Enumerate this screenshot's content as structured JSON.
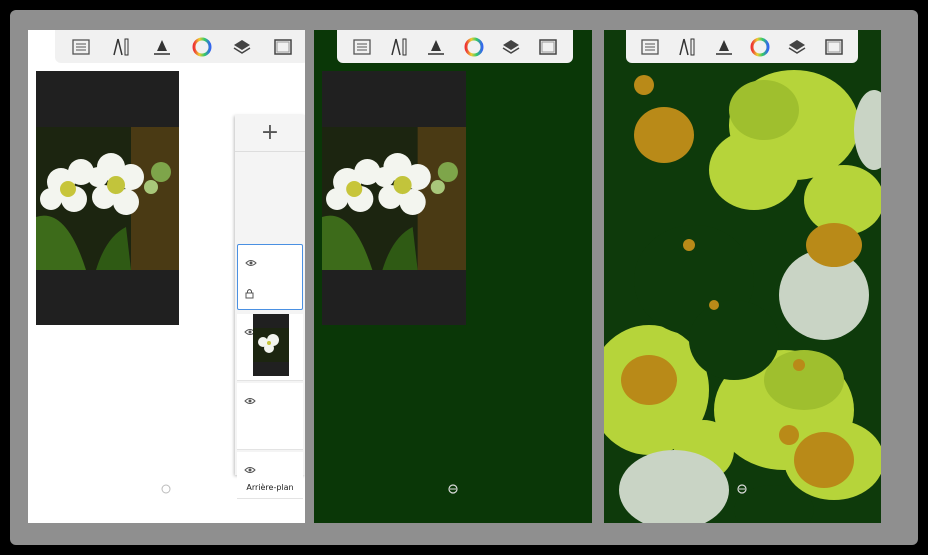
{
  "toolbar": {
    "icons": [
      "list-icon",
      "ruler-compass-icon",
      "symmetry-icon",
      "color-wheel-icon",
      "layers-icon",
      "canvas-frame-icon"
    ]
  },
  "layers_panel": {
    "add_button": "+",
    "background_label": "Arrière-plan"
  },
  "colors": {
    "panel2_background": "#0a3707",
    "panel3_background": "#0e3a0b",
    "splat_lime": "#b6d43a",
    "splat_pale": "#c9d4c5",
    "splat_ochre": "#b98a18",
    "selection_blue": "#4a90e2"
  }
}
